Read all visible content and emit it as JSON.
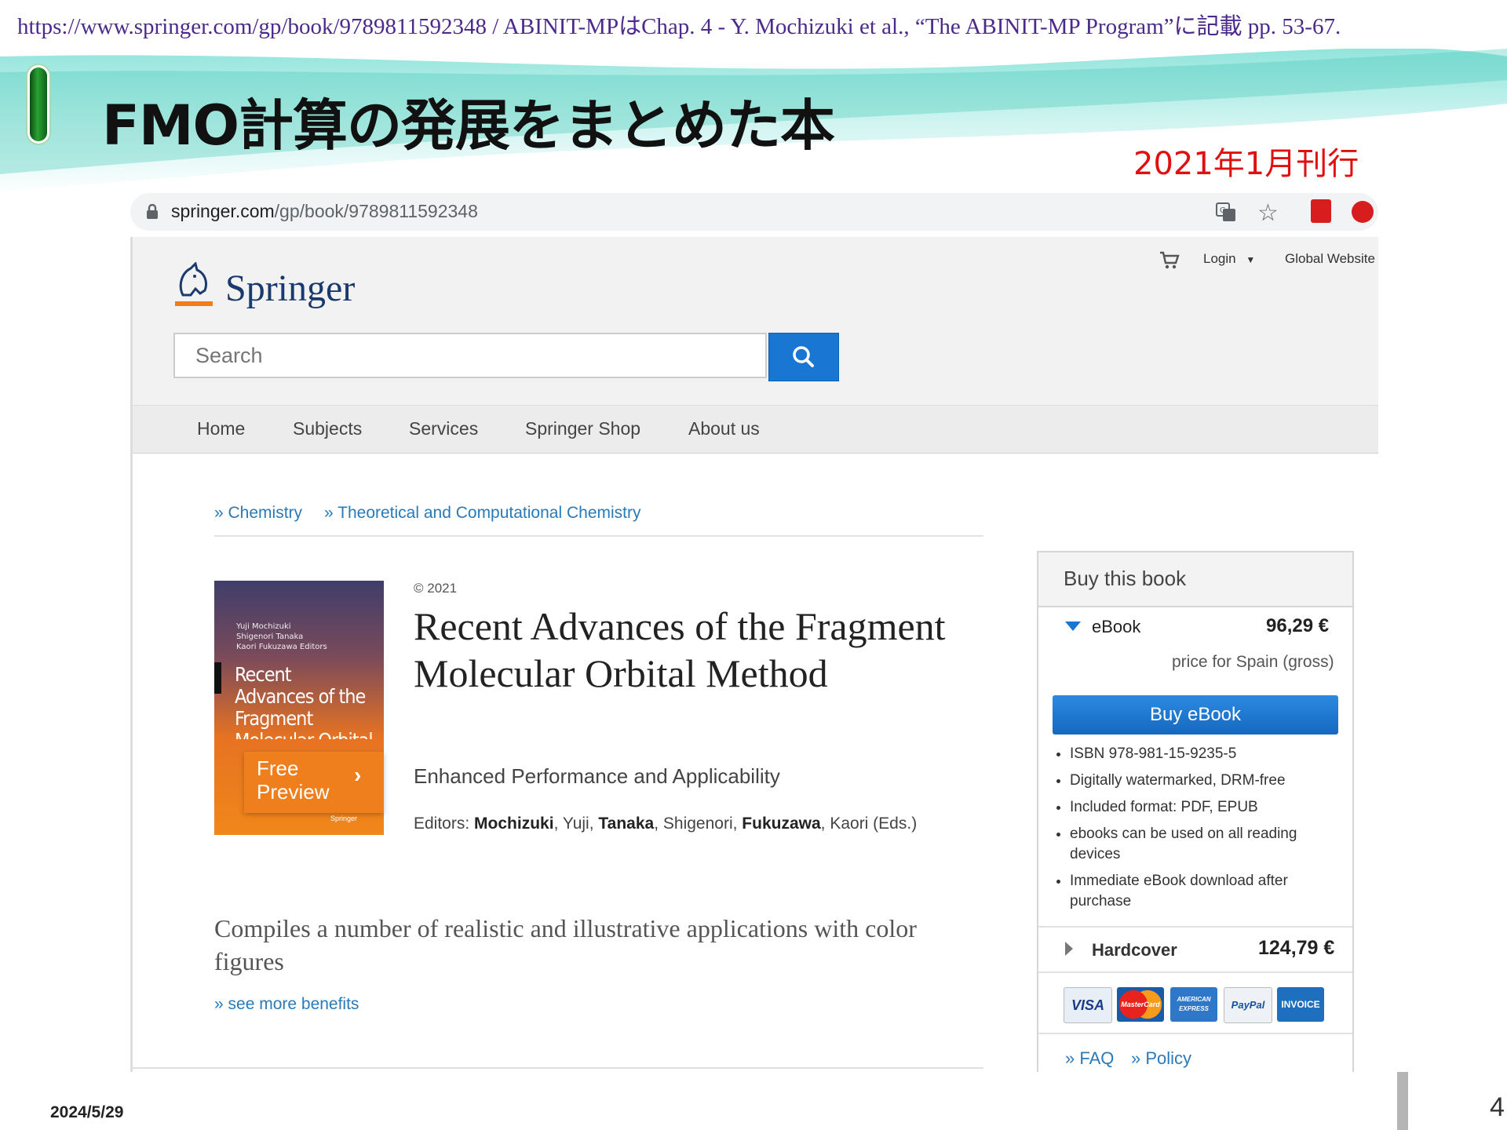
{
  "slide": {
    "citation": "https://www.springer.com/gp/book/9789811592348 / ABINIT-MPはChap. 4 - Y. Mochizuki et al., “The ABINIT-MP Program”に記載 pp. 53-67.",
    "title": "FMO計算の発展をまとめた本",
    "publication_note": "2021年1月刊行",
    "date": "2024/5/29",
    "page_number": "4"
  },
  "browser": {
    "url_host": "springer.com",
    "url_path": "/gp/book/9789811592348",
    "icons": [
      "lock-icon",
      "translate-icon",
      "star-icon",
      "pdf-icon",
      "trend-icon"
    ]
  },
  "site": {
    "logo": "Springer",
    "login": "Login",
    "global": "Global Website",
    "search_placeholder": "Search",
    "nav": [
      "Home",
      "Subjects",
      "Services",
      "Springer Shop",
      "About us"
    ],
    "breadcrumbs": [
      "» Chemistry",
      "» Theoretical and Computational Chemistry"
    ]
  },
  "book": {
    "cover_authors": [
      "Yuji Mochizuki",
      "Shigenori Tanaka",
      "Kaori Fukuzawa Editors"
    ],
    "cover_title": "Recent Advances of the Fragment Molecular Orbital Method",
    "cover_publisher": "Springer",
    "preview": "Free Preview",
    "copyright": "© 2021",
    "title": "Recent Advances of the Fragment Molecular Orbital Method",
    "subtitle": "Enhanced Performance and Applicability",
    "editors_label": "Editors:",
    "editors": [
      {
        "last": "Mochizuki",
        "first": "Yuji"
      },
      {
        "last": "Tanaka",
        "first": "Shigenori"
      },
      {
        "last": "Fukuzawa",
        "first": "Kaori (Eds.)"
      }
    ],
    "benefit": "Compiles a number of realistic and illustrative applications with color figures",
    "more_link": "» see more benefits"
  },
  "buybox": {
    "title": "Buy this book",
    "ebook_label": "eBook",
    "ebook_price": "96,29 €",
    "price_note": "price for Spain (gross)",
    "buy_button": "Buy eBook",
    "features": [
      "ISBN 978-981-15-9235-5",
      "Digitally watermarked, DRM-free",
      "Included format: PDF, EPUB",
      "ebooks can be used on all reading devices",
      "Immediate eBook download after purchase"
    ],
    "hardcover_label": "Hardcover",
    "hardcover_price": "124,79 €",
    "payments": [
      "VISA",
      "MasterCard",
      "AMERICAN EXPRESS",
      "PayPal",
      "INVOICE"
    ],
    "faq": "» FAQ",
    "policy": "» Policy"
  },
  "colors": {
    "accent_blue": "#1976d2",
    "link_blue": "#2a7ab8",
    "title_red": "#e01010",
    "cover_orange": "#ef7e1c"
  }
}
